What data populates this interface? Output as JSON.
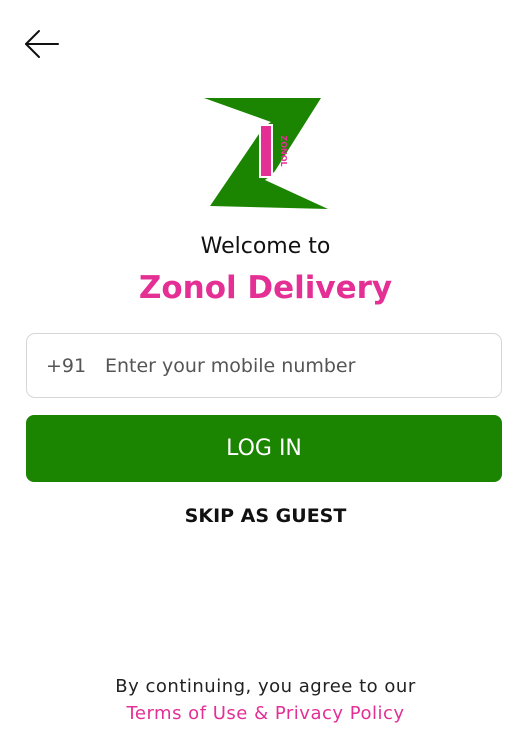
{
  "header": {
    "back_icon": "arrow-left-icon"
  },
  "logo": {
    "vertical_text": "ZONOL",
    "colors": {
      "green": "#1b8400",
      "pink": "#e42f95"
    }
  },
  "welcome": {
    "line1": "Welcome to",
    "app_name": "Zonol Delivery"
  },
  "phone": {
    "country_code": "+91",
    "placeholder": "Enter your mobile number",
    "value": ""
  },
  "actions": {
    "login_label": "LOG IN",
    "skip_label": "SKIP AS GUEST"
  },
  "footer": {
    "text": "By continuing, you agree to our",
    "link": "Terms of Use & Privacy Policy"
  },
  "colors": {
    "primary": "#1b8400",
    "accent": "#e42f95",
    "text": "#111111",
    "border": "#d6d6d6",
    "background": "#ffffff"
  }
}
